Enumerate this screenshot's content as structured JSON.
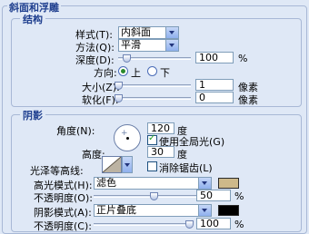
{
  "panel_title": "斜面和浮雕",
  "structure": {
    "legend": "结构",
    "style_label": "样式(T):",
    "style_value": "内斜面",
    "technique_label": "方法(Q):",
    "technique_value": "平滑",
    "depth_label": "深度(D):",
    "depth_value": "100",
    "depth_unit": "%",
    "depth_level": 0.1,
    "direction_label": "方向:",
    "direction_up": "上",
    "direction_down": "下",
    "direction_selected": "up",
    "size_label": "大小(Z):",
    "size_value": "1",
    "size_unit": "像素",
    "size_level": 0.0,
    "soften_label": "软化(F):",
    "soften_value": "0",
    "soften_unit": "像素",
    "soften_level": 0.0
  },
  "shading": {
    "legend": "阴影",
    "angle_label": "角度(N):",
    "angle_value": "120",
    "angle_unit": "度",
    "global_light_label": "使用全局光(G)",
    "global_light_checked": true,
    "altitude_label": "高度:",
    "altitude_value": "30",
    "altitude_unit": "度",
    "gloss_label": "光泽等高线:",
    "antialias_label": "消除锯齿(L)",
    "antialias_checked": false,
    "highlight_mode_label": "高光模式(H):",
    "highlight_mode_value": "滤色",
    "highlight_color": "#cdb98a",
    "highlight_opacity_label": "不透明度(O):",
    "highlight_opacity_value": "50",
    "highlight_opacity_unit": "%",
    "highlight_opacity_level": 0.5,
    "shadow_mode_label": "阴影模式(A):",
    "shadow_mode_value": "正片叠底",
    "shadow_color": "#000000",
    "shadow_opacity_label": "不透明度(C):",
    "shadow_opacity_value": "100",
    "shadow_opacity_unit": "%",
    "shadow_opacity_level": 1.0
  }
}
